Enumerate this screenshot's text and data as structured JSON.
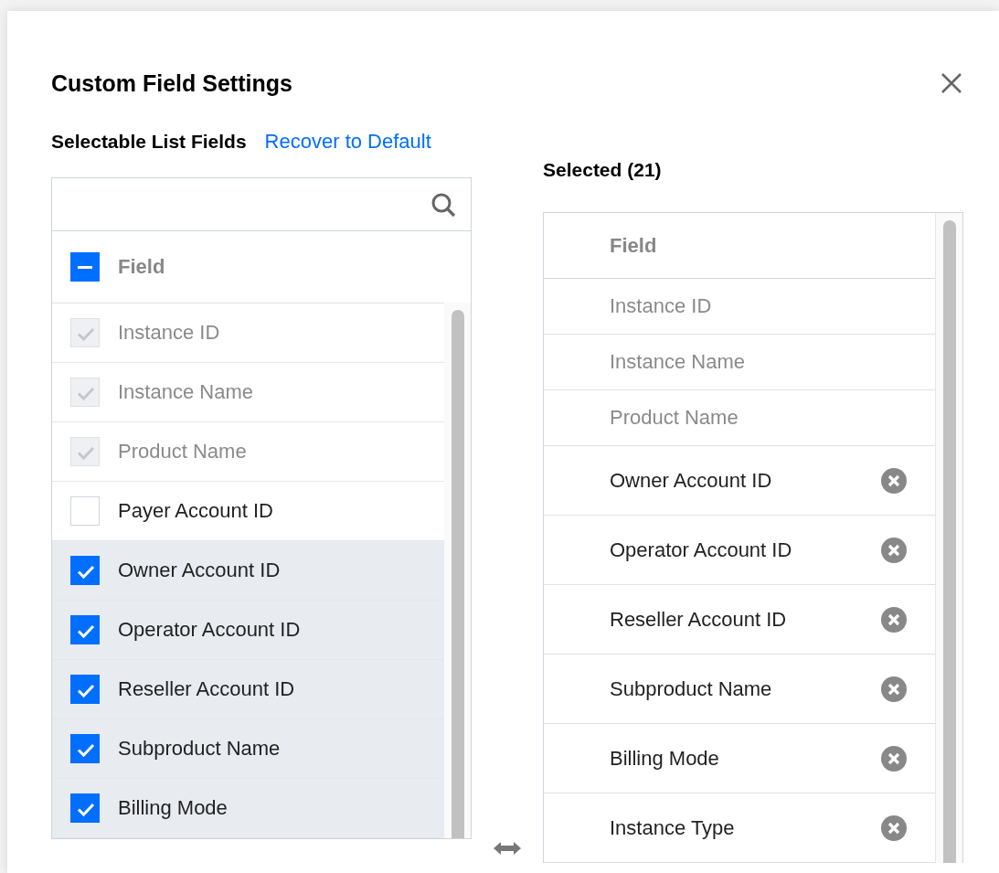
{
  "dialog": {
    "title": "Custom Field Settings"
  },
  "selectable": {
    "heading": "Selectable List Fields",
    "reset_link": "Recover to Default",
    "header": {
      "label": "Field",
      "indeterminate": true
    },
    "items": [
      {
        "label": "Instance ID",
        "checked": true,
        "disabled": true
      },
      {
        "label": "Instance Name",
        "checked": true,
        "disabled": true
      },
      {
        "label": "Product Name",
        "checked": true,
        "disabled": true
      },
      {
        "label": "Payer Account ID",
        "checked": false,
        "disabled": false
      },
      {
        "label": "Owner Account ID",
        "checked": true,
        "disabled": false
      },
      {
        "label": "Operator Account ID",
        "checked": true,
        "disabled": false
      },
      {
        "label": "Reseller Account ID",
        "checked": true,
        "disabled": false
      },
      {
        "label": "Subproduct Name",
        "checked": true,
        "disabled": false
      },
      {
        "label": "Billing Mode",
        "checked": true,
        "disabled": false
      }
    ]
  },
  "selected": {
    "heading": "Selected (21)",
    "header": "Field",
    "items": [
      {
        "label": "Instance ID",
        "removable": false
      },
      {
        "label": "Instance Name",
        "removable": false
      },
      {
        "label": "Product Name",
        "removable": false
      },
      {
        "label": "Owner Account ID",
        "removable": true
      },
      {
        "label": "Operator Account ID",
        "removable": true
      },
      {
        "label": "Reseller Account ID",
        "removable": true
      },
      {
        "label": "Subproduct Name",
        "removable": true
      },
      {
        "label": "Billing Mode",
        "removable": true
      },
      {
        "label": "Instance Type",
        "removable": true
      }
    ]
  }
}
